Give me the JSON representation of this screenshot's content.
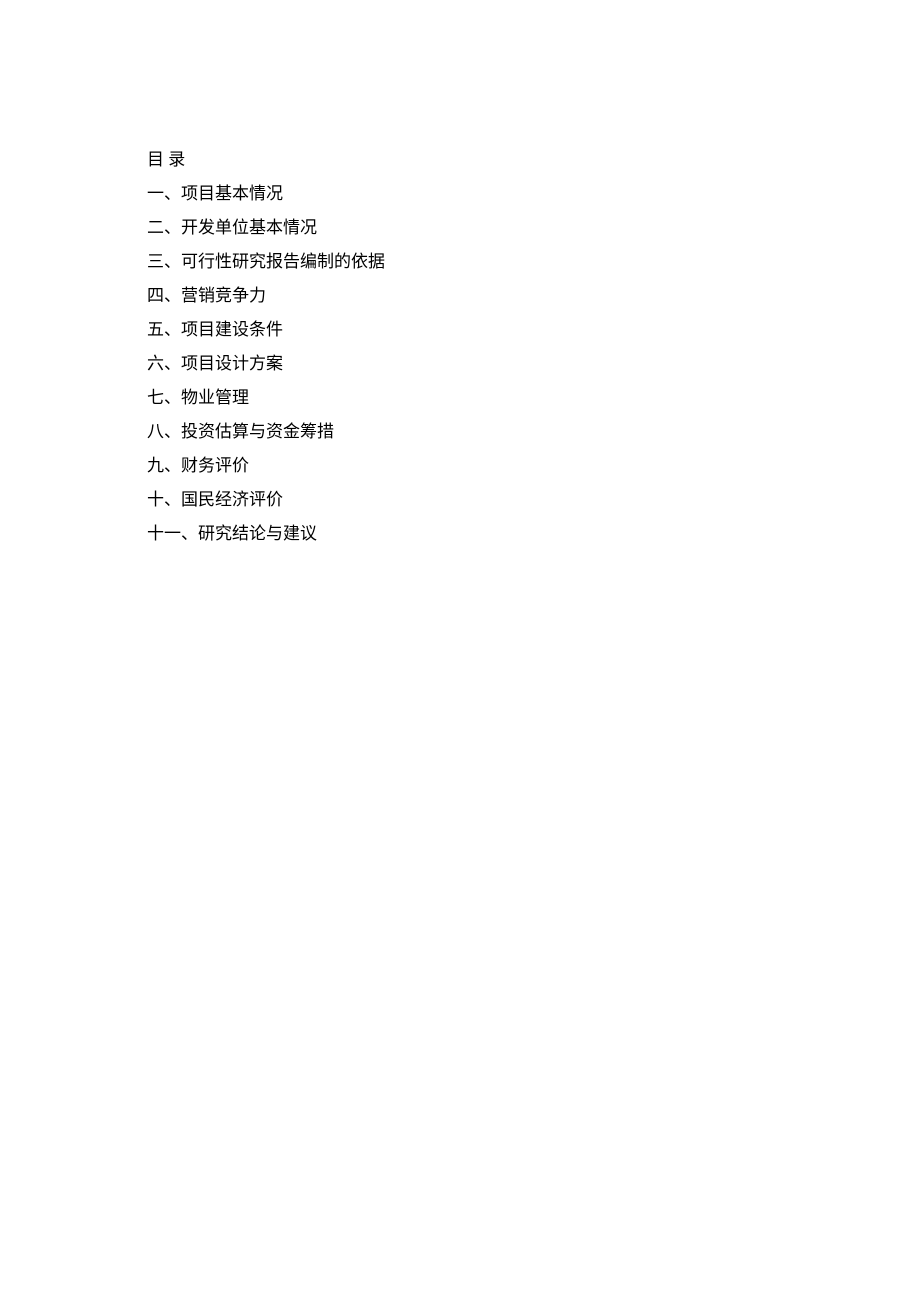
{
  "title": "目 录",
  "toc": [
    "一、项目基本情况",
    "二、开发单位基本情况",
    "三、可行性研究报告编制的依据",
    "四、营销竞争力",
    "五、项目建设条件",
    "六、项目设计方案",
    "七、物业管理",
    "八、投资估算与资金筹措",
    "九、财务评价",
    "十、国民经济评价",
    "十一、研究结论与建议"
  ]
}
